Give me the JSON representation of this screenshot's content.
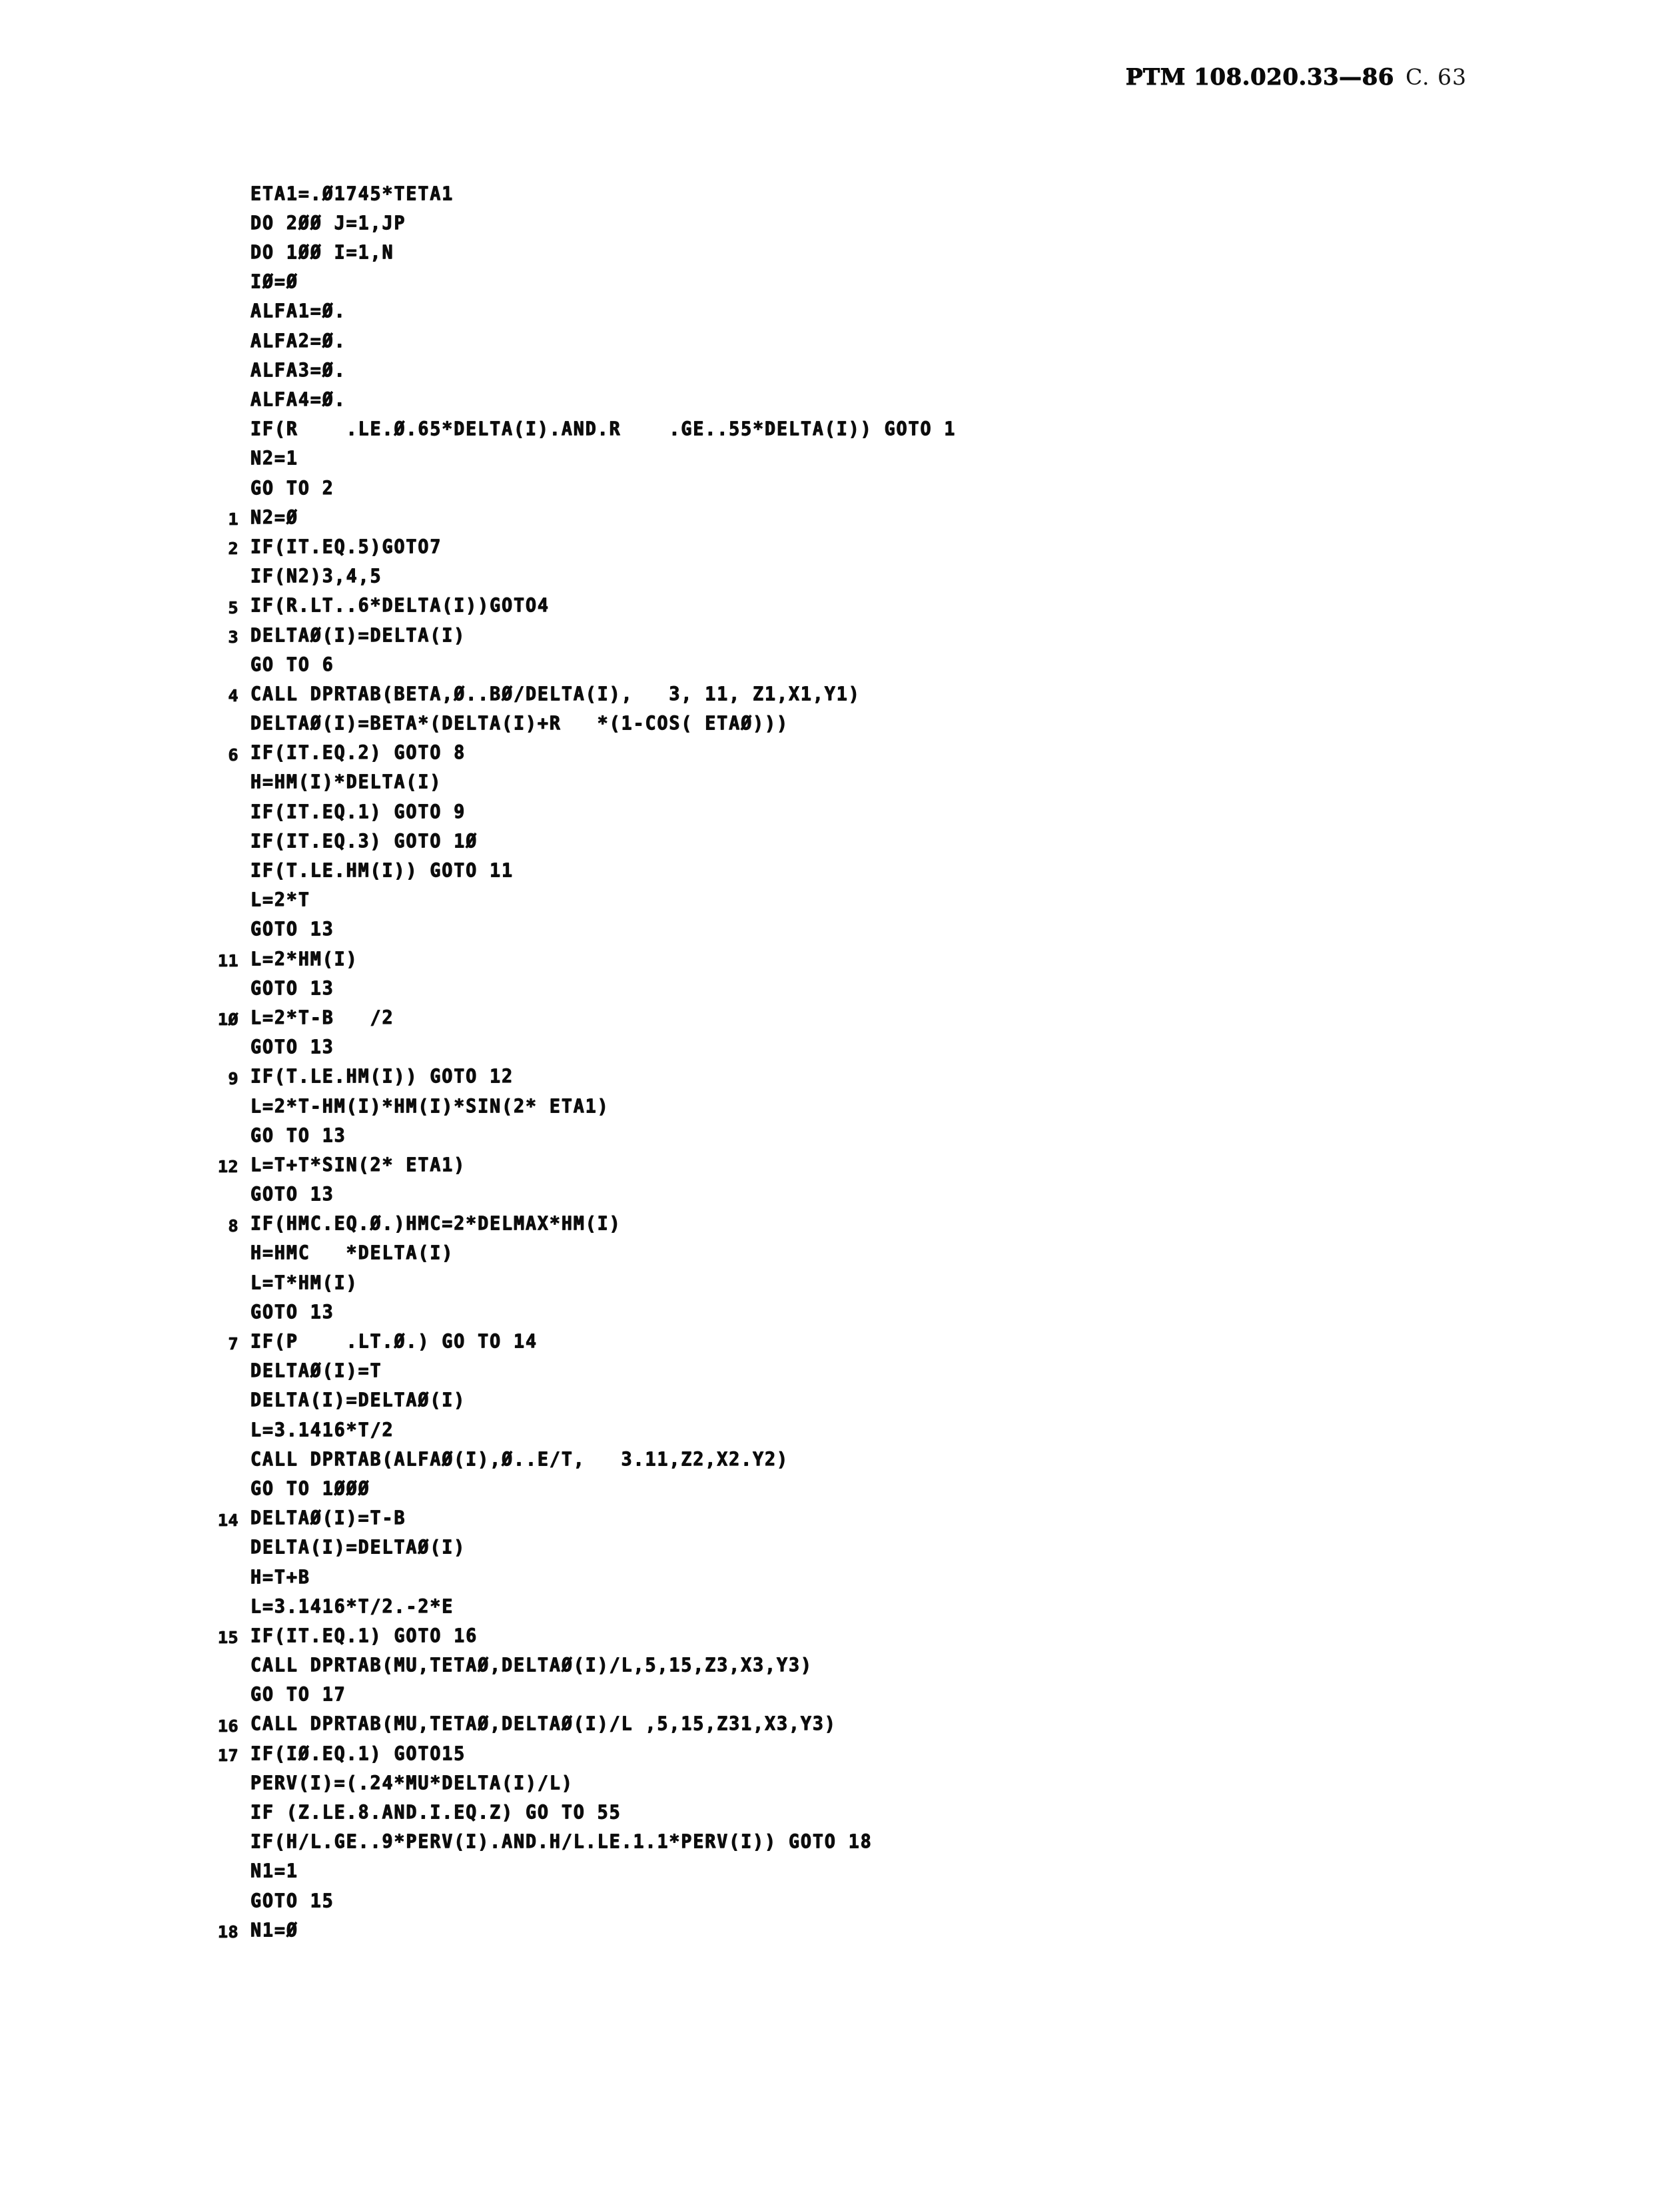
{
  "header": {
    "document_code": "PTM 108.020.33—86",
    "page_marker": "C. 63"
  },
  "listing": {
    "language": "FORTRAN",
    "lines": [
      {
        "label": "",
        "text": "ETA1=.Ø1745*TETA1"
      },
      {
        "label": "",
        "text": "DO 2ØØ J=1,JP"
      },
      {
        "label": "",
        "text": "DO 1ØØ I=1,N"
      },
      {
        "label": "",
        "text": "IØ=Ø"
      },
      {
        "label": "",
        "text": "ALFA1=Ø."
      },
      {
        "label": "",
        "text": "ALFA2=Ø."
      },
      {
        "label": "",
        "text": "ALFA3=Ø."
      },
      {
        "label": "",
        "text": "ALFA4=Ø."
      },
      {
        "label": "",
        "text": "IF(R    .LE.Ø.65*DELTA(I).AND.R    .GE..55*DELTA(I)) GOTO 1"
      },
      {
        "label": "",
        "text": "N2=1"
      },
      {
        "label": "",
        "text": "GO TO 2"
      },
      {
        "label": "1",
        "text": "N2=Ø"
      },
      {
        "label": "2",
        "text": "IF(IT.EQ.5)GOTO7"
      },
      {
        "label": "",
        "text": "IF(N2)3,4,5"
      },
      {
        "label": "5",
        "text": "IF(R.LT..6*DELTA(I))GOTO4"
      },
      {
        "label": "3",
        "text": "DELTAØ(I)=DELTA(I)"
      },
      {
        "label": "",
        "text": "GO TO 6"
      },
      {
        "label": "4",
        "text": "CALL DPRTAB(BETA,Ø..BØ/DELTA(I),   3, 11, Z1,X1,Y1)"
      },
      {
        "label": "",
        "text": "DELTAØ(I)=BETA*(DELTA(I)+R   *(1-COS( ETAØ)))"
      },
      {
        "label": "6",
        "text": "IF(IT.EQ.2) GOTO 8"
      },
      {
        "label": "",
        "text": "H=HM(I)*DELTA(I)"
      },
      {
        "label": "",
        "text": "IF(IT.EQ.1) GOTO 9"
      },
      {
        "label": "",
        "text": "IF(IT.EQ.3) GOTO 1Ø"
      },
      {
        "label": "",
        "text": "IF(T.LE.HM(I)) GOTO 11"
      },
      {
        "label": "",
        "text": "L=2*T"
      },
      {
        "label": "",
        "text": "GOTO 13"
      },
      {
        "label": "11",
        "text": "L=2*HM(I)"
      },
      {
        "label": "",
        "text": "GOTO 13"
      },
      {
        "label": "1Ø",
        "text": "L=2*T-B   /2"
      },
      {
        "label": "",
        "text": "GOTO 13"
      },
      {
        "label": "9",
        "text": "IF(T.LE.HM(I)) GOTO 12"
      },
      {
        "label": "",
        "text": "L=2*T-HM(I)*HM(I)*SIN(2* ETA1)"
      },
      {
        "label": "",
        "text": "GO TO 13"
      },
      {
        "label": "12",
        "text": "L=T+T*SIN(2* ETA1)"
      },
      {
        "label": "",
        "text": "GOTO 13"
      },
      {
        "label": "8",
        "text": "IF(HMC.EQ.Ø.)HMC=2*DELMAX*HM(I)"
      },
      {
        "label": "",
        "text": "H=HMC   *DELTA(I)"
      },
      {
        "label": "",
        "text": "L=T*HM(I)"
      },
      {
        "label": "",
        "text": "GOTO 13"
      },
      {
        "label": "7",
        "text": "IF(P    .LT.Ø.) GO TO 14"
      },
      {
        "label": "",
        "text": "DELTAØ(I)=T"
      },
      {
        "label": "",
        "text": "DELTA(I)=DELTAØ(I)"
      },
      {
        "label": "",
        "text": "L=3.1416*T/2"
      },
      {
        "label": "",
        "text": "CALL DPRTAB(ALFAØ(I),Ø..E/T,   3.11,Z2,X2.Y2)"
      },
      {
        "label": "",
        "text": "GO TO 1ØØØ"
      },
      {
        "label": "14",
        "text": "DELTAØ(I)=T-B"
      },
      {
        "label": "",
        "text": "DELTA(I)=DELTAØ(I)"
      },
      {
        "label": "",
        "text": "H=T+B"
      },
      {
        "label": "",
        "text": "L=3.1416*T/2.-2*E"
      },
      {
        "label": "15",
        "text": "IF(IT.EQ.1) GOTO 16"
      },
      {
        "label": "",
        "text": "CALL DPRTAB(MU,TETAØ,DELTAØ(I)/L,5,15,Z3,X3,Y3)"
      },
      {
        "label": "",
        "text": "GO TO 17"
      },
      {
        "label": "16",
        "text": "CALL DPRTAB(MU,TETAØ,DELTAØ(I)/L ,5,15,Z31,X3,Y3)"
      },
      {
        "label": "17",
        "text": "IF(IØ.EQ.1) GOTO15"
      },
      {
        "label": "",
        "text": "PERV(I)=(.24*MU*DELTA(I)/L)"
      },
      {
        "label": "",
        "text": "IF (Z.LE.8.AND.I.EQ.Z) GO TO 55"
      },
      {
        "label": "",
        "text": "IF(H/L.GE..9*PERV(I).AND.H/L.LE.1.1*PERV(I)) GOTO 18"
      },
      {
        "label": "",
        "text": "N1=1"
      },
      {
        "label": "",
        "text": "GOTO 15"
      },
      {
        "label": "18",
        "text": "N1=Ø"
      }
    ]
  }
}
